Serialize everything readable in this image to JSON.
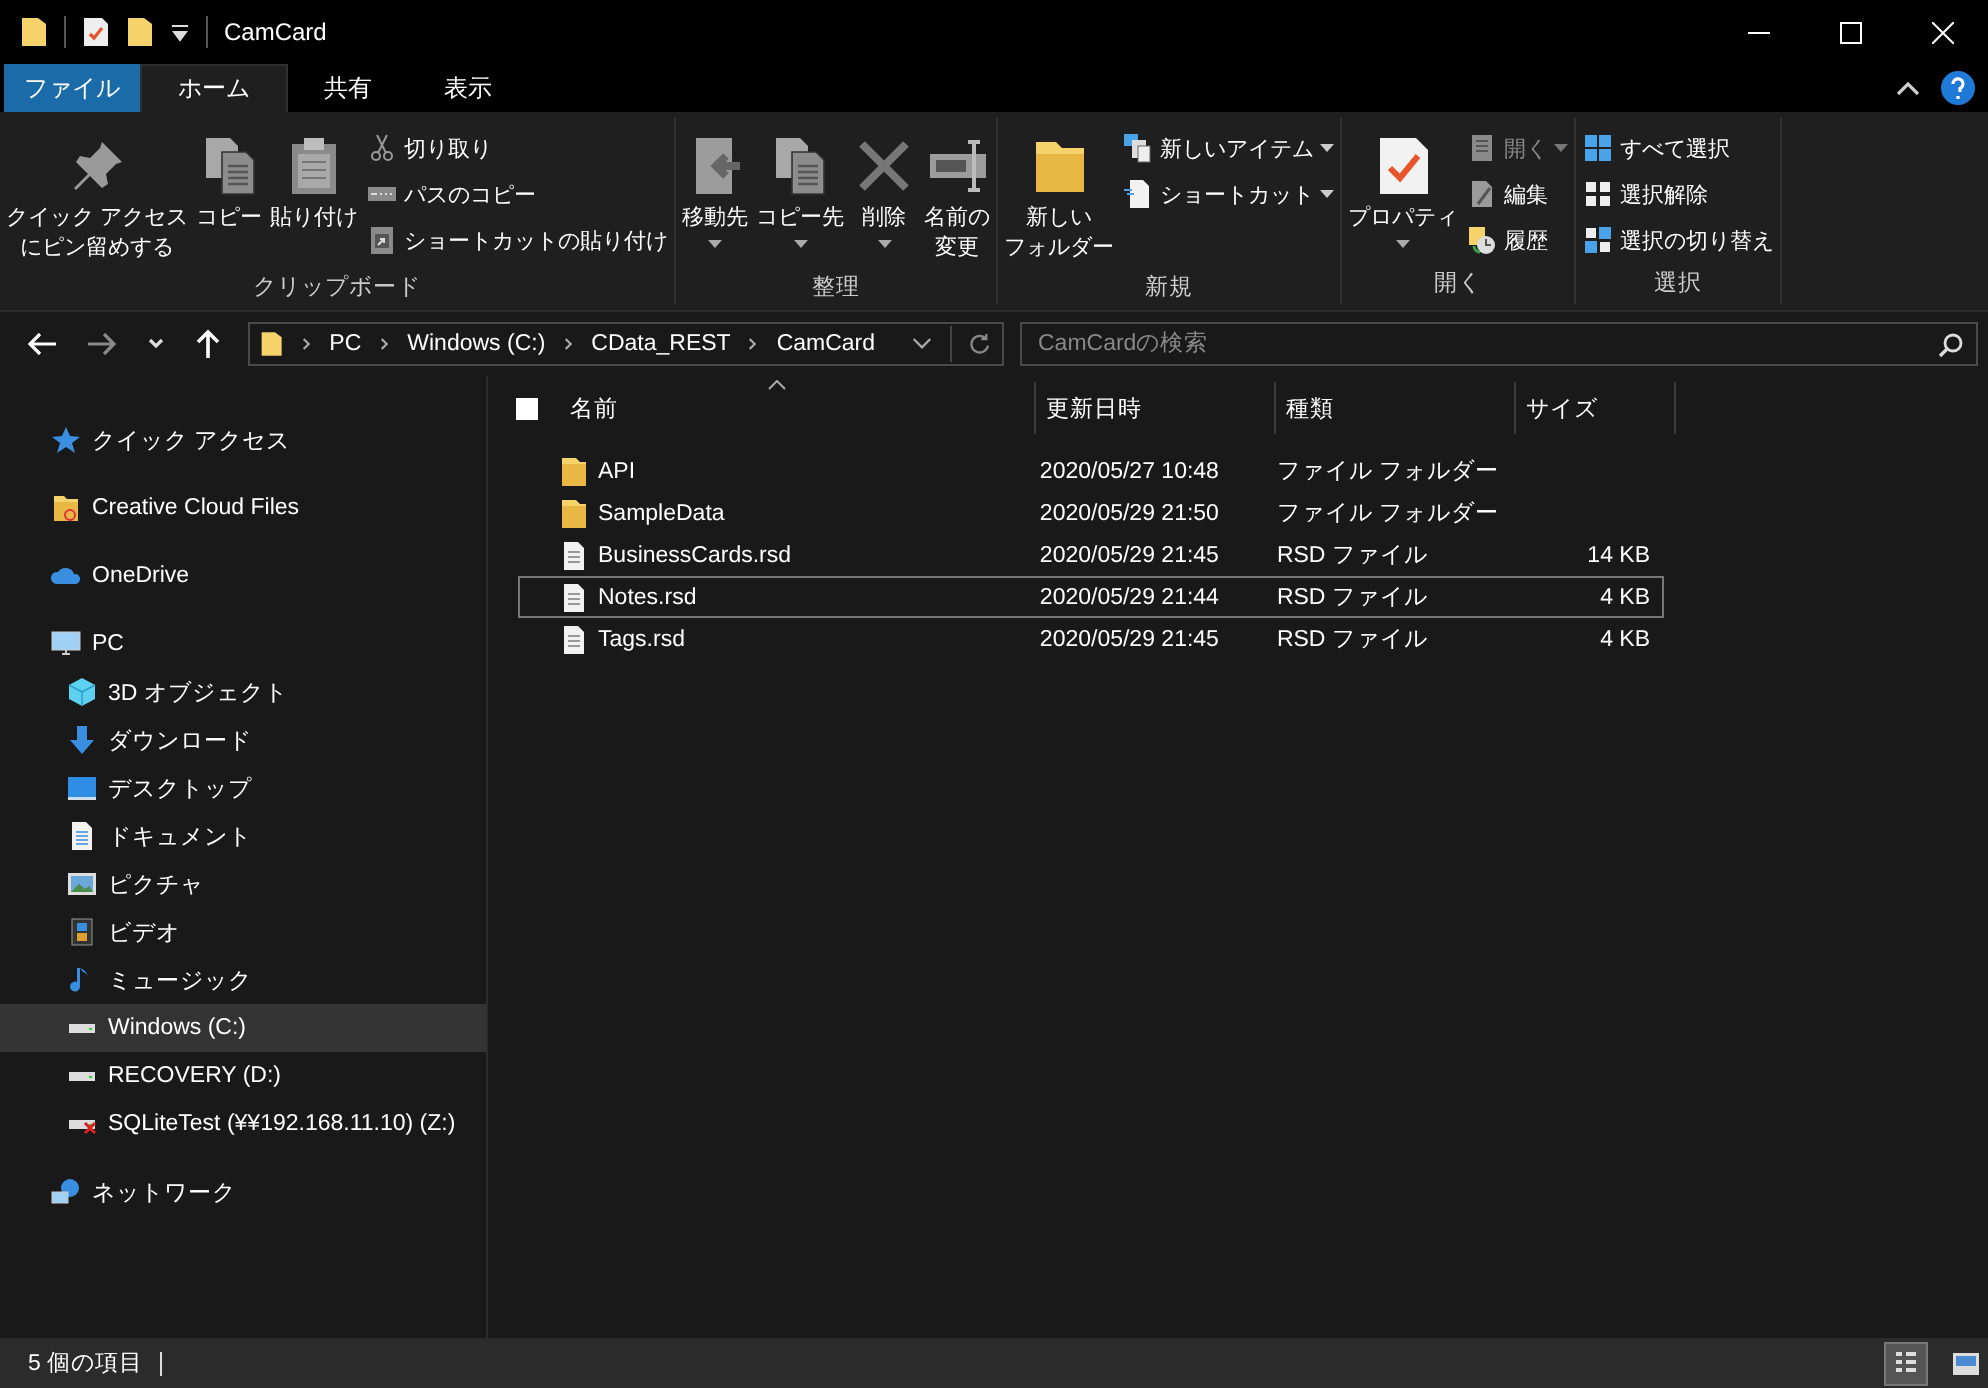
{
  "window": {
    "title": "CamCard"
  },
  "tabs": [
    {
      "label": "ファイル",
      "kind": "file",
      "selected": false
    },
    {
      "label": "ホーム",
      "kind": "tab",
      "selected": true
    },
    {
      "label": "共有",
      "kind": "tab",
      "selected": false
    },
    {
      "label": "表示",
      "kind": "tab",
      "selected": false
    }
  ],
  "ribbon": {
    "groups": [
      {
        "label": "クリップボード",
        "items": [
          {
            "kind": "large",
            "lines": [
              "クイック アクセス",
              "にピン留めする"
            ],
            "disabled": false,
            "dropdown": false
          },
          {
            "kind": "large",
            "lines": [
              "コピー"
            ],
            "disabled": false,
            "dropdown": false
          },
          {
            "kind": "large",
            "lines": [
              "貼り付け"
            ],
            "disabled": false,
            "dropdown": false
          },
          {
            "kind": "small",
            "label": "切り取り",
            "disabled": false,
            "dropdown": false
          },
          {
            "kind": "small",
            "label": "パスのコピー",
            "disabled": false,
            "dropdown": false
          },
          {
            "kind": "small",
            "label": "ショートカットの貼り付け",
            "disabled": false,
            "dropdown": false
          }
        ]
      },
      {
        "label": "整理",
        "items": [
          {
            "kind": "large",
            "lines": [
              "移動先"
            ],
            "disabled": false,
            "dropdown": true
          },
          {
            "kind": "large",
            "lines": [
              "コピー先"
            ],
            "disabled": false,
            "dropdown": true
          },
          {
            "kind": "large",
            "lines": [
              "削除"
            ],
            "disabled": false,
            "dropdown": true
          },
          {
            "kind": "large",
            "lines": [
              "名前の",
              "変更"
            ],
            "disabled": false,
            "dropdown": false
          }
        ]
      },
      {
        "label": "新規",
        "items": [
          {
            "kind": "large",
            "lines": [
              "新しい",
              "フォルダー"
            ],
            "disabled": false,
            "dropdown": false
          },
          {
            "kind": "small",
            "label": "新しいアイテム",
            "disabled": false,
            "dropdown": true
          },
          {
            "kind": "small",
            "label": "ショートカット",
            "disabled": false,
            "dropdown": true
          }
        ]
      },
      {
        "label": "開く",
        "items": [
          {
            "kind": "large",
            "lines": [
              "プロパティ"
            ],
            "disabled": false,
            "dropdown": true
          },
          {
            "kind": "small",
            "label": "開く",
            "disabled": true,
            "dropdown": true
          },
          {
            "kind": "small",
            "label": "編集",
            "disabled": false,
            "dropdown": false
          },
          {
            "kind": "small",
            "label": "履歴",
            "disabled": false,
            "dropdown": false
          }
        ]
      },
      {
        "label": "選択",
        "items": [
          {
            "kind": "small",
            "label": "すべて選択",
            "disabled": false,
            "dropdown": false
          },
          {
            "kind": "small",
            "label": "選択解除",
            "disabled": false,
            "dropdown": false
          },
          {
            "kind": "small",
            "label": "選択の切り替え",
            "disabled": false,
            "dropdown": false
          }
        ]
      }
    ]
  },
  "address": {
    "path": [
      "PC",
      "Windows (C:)",
      "CData_REST",
      "CamCard"
    ]
  },
  "search": {
    "placeholder": "CamCardの検索"
  },
  "sidebar": {
    "items": [
      {
        "label": "クイック アクセス",
        "selected": false
      },
      {
        "label": "Creative Cloud Files",
        "selected": false
      },
      {
        "label": "OneDrive",
        "selected": false
      },
      {
        "label": "PC",
        "selected": false,
        "children": [
          {
            "label": "3D オブジェクト",
            "selected": false
          },
          {
            "label": "ダウンロード",
            "selected": false
          },
          {
            "label": "デスクトップ",
            "selected": false
          },
          {
            "label": "ドキュメント",
            "selected": false
          },
          {
            "label": "ピクチャ",
            "selected": false
          },
          {
            "label": "ビデオ",
            "selected": false
          },
          {
            "label": "ミュージック",
            "selected": false
          },
          {
            "label": "Windows (C:)",
            "selected": true
          },
          {
            "label": "RECOVERY (D:)",
            "selected": false
          },
          {
            "label": "SQLiteTest (¥¥192.168.11.10) (Z:)",
            "selected": false
          }
        ]
      },
      {
        "label": "ネットワーク",
        "selected": false
      }
    ]
  },
  "table": {
    "select_all_checked": false,
    "columns": [
      "名前",
      "更新日時",
      "種類",
      "サイズ"
    ],
    "rows": [
      {
        "kind": "folder",
        "name": "API",
        "date": "2020/05/27 10:48",
        "type": "ファイル フォルダー",
        "focused": false
      },
      {
        "kind": "folder",
        "name": "SampleData",
        "date": "2020/05/29 21:50",
        "type": "ファイル フォルダー",
        "focused": false
      },
      {
        "kind": "file",
        "name": "BusinessCards.rsd",
        "date": "2020/05/29 21:45",
        "type": "RSD ファイル",
        "size": "14 KB",
        "focused": false
      },
      {
        "kind": "file",
        "name": "Notes.rsd",
        "date": "2020/05/29 21:44",
        "type": "RSD ファイル",
        "size": "4 KB",
        "focused": true
      },
      {
        "kind": "file",
        "name": "Tags.rsd",
        "date": "2020/05/29 21:45",
        "type": "RSD ファイル",
        "size": "4 KB",
        "focused": false
      }
    ]
  },
  "status_bar": {
    "text": "5 個の項目",
    "views": [
      {
        "kind": "details",
        "selected": true
      },
      {
        "kind": "thumbnails",
        "selected": false
      }
    ]
  }
}
